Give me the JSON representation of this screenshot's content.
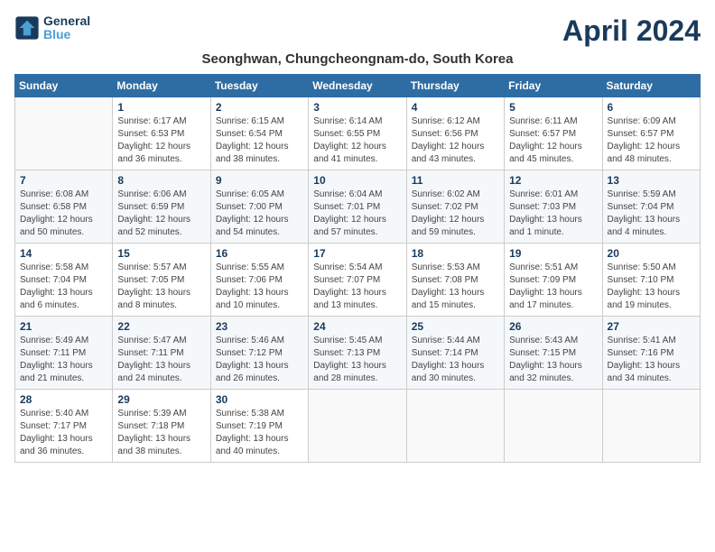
{
  "header": {
    "logo_line1": "General",
    "logo_line2": "Blue",
    "month_title": "April 2024",
    "subtitle": "Seonghwan, Chungcheongnam-do, South Korea"
  },
  "days_of_week": [
    "Sunday",
    "Monday",
    "Tuesday",
    "Wednesday",
    "Thursday",
    "Friday",
    "Saturday"
  ],
  "weeks": [
    [
      {
        "day": "",
        "content": ""
      },
      {
        "day": "1",
        "content": "Sunrise: 6:17 AM\nSunset: 6:53 PM\nDaylight: 12 hours\nand 36 minutes."
      },
      {
        "day": "2",
        "content": "Sunrise: 6:15 AM\nSunset: 6:54 PM\nDaylight: 12 hours\nand 38 minutes."
      },
      {
        "day": "3",
        "content": "Sunrise: 6:14 AM\nSunset: 6:55 PM\nDaylight: 12 hours\nand 41 minutes."
      },
      {
        "day": "4",
        "content": "Sunrise: 6:12 AM\nSunset: 6:56 PM\nDaylight: 12 hours\nand 43 minutes."
      },
      {
        "day": "5",
        "content": "Sunrise: 6:11 AM\nSunset: 6:57 PM\nDaylight: 12 hours\nand 45 minutes."
      },
      {
        "day": "6",
        "content": "Sunrise: 6:09 AM\nSunset: 6:57 PM\nDaylight: 12 hours\nand 48 minutes."
      }
    ],
    [
      {
        "day": "7",
        "content": "Sunrise: 6:08 AM\nSunset: 6:58 PM\nDaylight: 12 hours\nand 50 minutes."
      },
      {
        "day": "8",
        "content": "Sunrise: 6:06 AM\nSunset: 6:59 PM\nDaylight: 12 hours\nand 52 minutes."
      },
      {
        "day": "9",
        "content": "Sunrise: 6:05 AM\nSunset: 7:00 PM\nDaylight: 12 hours\nand 54 minutes."
      },
      {
        "day": "10",
        "content": "Sunrise: 6:04 AM\nSunset: 7:01 PM\nDaylight: 12 hours\nand 57 minutes."
      },
      {
        "day": "11",
        "content": "Sunrise: 6:02 AM\nSunset: 7:02 PM\nDaylight: 12 hours\nand 59 minutes."
      },
      {
        "day": "12",
        "content": "Sunrise: 6:01 AM\nSunset: 7:03 PM\nDaylight: 13 hours\nand 1 minute."
      },
      {
        "day": "13",
        "content": "Sunrise: 5:59 AM\nSunset: 7:04 PM\nDaylight: 13 hours\nand 4 minutes."
      }
    ],
    [
      {
        "day": "14",
        "content": "Sunrise: 5:58 AM\nSunset: 7:04 PM\nDaylight: 13 hours\nand 6 minutes."
      },
      {
        "day": "15",
        "content": "Sunrise: 5:57 AM\nSunset: 7:05 PM\nDaylight: 13 hours\nand 8 minutes."
      },
      {
        "day": "16",
        "content": "Sunrise: 5:55 AM\nSunset: 7:06 PM\nDaylight: 13 hours\nand 10 minutes."
      },
      {
        "day": "17",
        "content": "Sunrise: 5:54 AM\nSunset: 7:07 PM\nDaylight: 13 hours\nand 13 minutes."
      },
      {
        "day": "18",
        "content": "Sunrise: 5:53 AM\nSunset: 7:08 PM\nDaylight: 13 hours\nand 15 minutes."
      },
      {
        "day": "19",
        "content": "Sunrise: 5:51 AM\nSunset: 7:09 PM\nDaylight: 13 hours\nand 17 minutes."
      },
      {
        "day": "20",
        "content": "Sunrise: 5:50 AM\nSunset: 7:10 PM\nDaylight: 13 hours\nand 19 minutes."
      }
    ],
    [
      {
        "day": "21",
        "content": "Sunrise: 5:49 AM\nSunset: 7:11 PM\nDaylight: 13 hours\nand 21 minutes."
      },
      {
        "day": "22",
        "content": "Sunrise: 5:47 AM\nSunset: 7:11 PM\nDaylight: 13 hours\nand 24 minutes."
      },
      {
        "day": "23",
        "content": "Sunrise: 5:46 AM\nSunset: 7:12 PM\nDaylight: 13 hours\nand 26 minutes."
      },
      {
        "day": "24",
        "content": "Sunrise: 5:45 AM\nSunset: 7:13 PM\nDaylight: 13 hours\nand 28 minutes."
      },
      {
        "day": "25",
        "content": "Sunrise: 5:44 AM\nSunset: 7:14 PM\nDaylight: 13 hours\nand 30 minutes."
      },
      {
        "day": "26",
        "content": "Sunrise: 5:43 AM\nSunset: 7:15 PM\nDaylight: 13 hours\nand 32 minutes."
      },
      {
        "day": "27",
        "content": "Sunrise: 5:41 AM\nSunset: 7:16 PM\nDaylight: 13 hours\nand 34 minutes."
      }
    ],
    [
      {
        "day": "28",
        "content": "Sunrise: 5:40 AM\nSunset: 7:17 PM\nDaylight: 13 hours\nand 36 minutes."
      },
      {
        "day": "29",
        "content": "Sunrise: 5:39 AM\nSunset: 7:18 PM\nDaylight: 13 hours\nand 38 minutes."
      },
      {
        "day": "30",
        "content": "Sunrise: 5:38 AM\nSunset: 7:19 PM\nDaylight: 13 hours\nand 40 minutes."
      },
      {
        "day": "",
        "content": ""
      },
      {
        "day": "",
        "content": ""
      },
      {
        "day": "",
        "content": ""
      },
      {
        "day": "",
        "content": ""
      }
    ]
  ]
}
